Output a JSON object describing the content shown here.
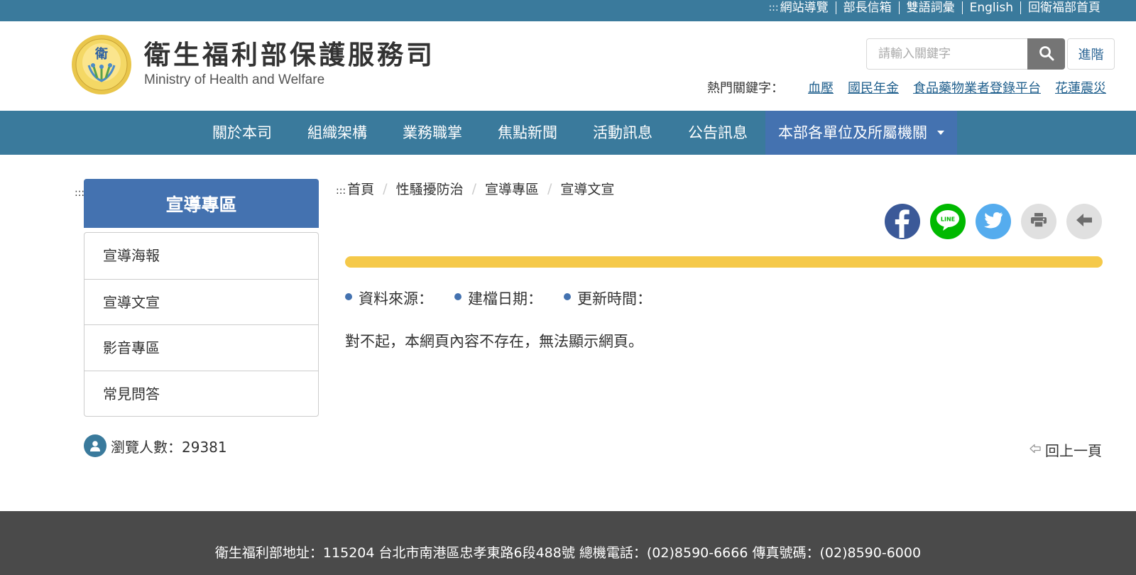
{
  "topbar": {
    "anchor": ":::",
    "links": [
      "網站導覽",
      "部長信箱",
      "雙語詞彙",
      "English",
      "回衛福部首頁"
    ]
  },
  "header": {
    "title": "衛生福利部保護服務司",
    "subtitle": "Ministry of Health and Welfare",
    "logo_icon": "mohw-logo",
    "search_placeholder": "請輸入關鍵字",
    "search_icon": "search-icon",
    "advanced_label": "進階",
    "hot_label": "熱門關鍵字：",
    "hot_keywords": [
      "血壓",
      "國民年金",
      "食品藥物業者登錄平台",
      "花蓮震災"
    ]
  },
  "nav": {
    "items": [
      "關於本司",
      "組織架構",
      "業務職掌",
      "焦點新聞",
      "活動訊息",
      "公告訊息"
    ],
    "active_item": "本部各單位及所屬機關"
  },
  "sidebar": {
    "anchor": ":::",
    "title": "宣導專區",
    "items": [
      "宣導海報",
      "宣導文宣",
      "影音專區",
      "常見問答"
    ],
    "visitor_label": "瀏覽人數：29381"
  },
  "breadcrumb": {
    "anchor": ":::",
    "items": [
      "首頁",
      "性騷擾防治",
      "宣導專區",
      "宣導文宣"
    ],
    "separator": "/"
  },
  "share": {
    "buttons": [
      "facebook",
      "line",
      "twitter",
      "print",
      "back"
    ],
    "line_label": "LINE"
  },
  "content": {
    "meta": [
      "資料來源：",
      "建檔日期：",
      "更新時間："
    ],
    "message": "對不起，本網頁內容不存在，無法顯示網頁。",
    "back_label": "回上一頁"
  },
  "footer": {
    "text": "衛生福利部地址：115204 台北市南港區忠孝東路6段488號 總機電話：(02)8590-6666 傳真號碼：(02)8590-6000"
  },
  "colors": {
    "primary": "#3a7a9c",
    "accent_blue": "#4472b0",
    "yellow": "#f5c94a",
    "footer": "#4a4a4a",
    "facebook": "#3b5998",
    "line": "#00b900",
    "twitter": "#55acee"
  }
}
